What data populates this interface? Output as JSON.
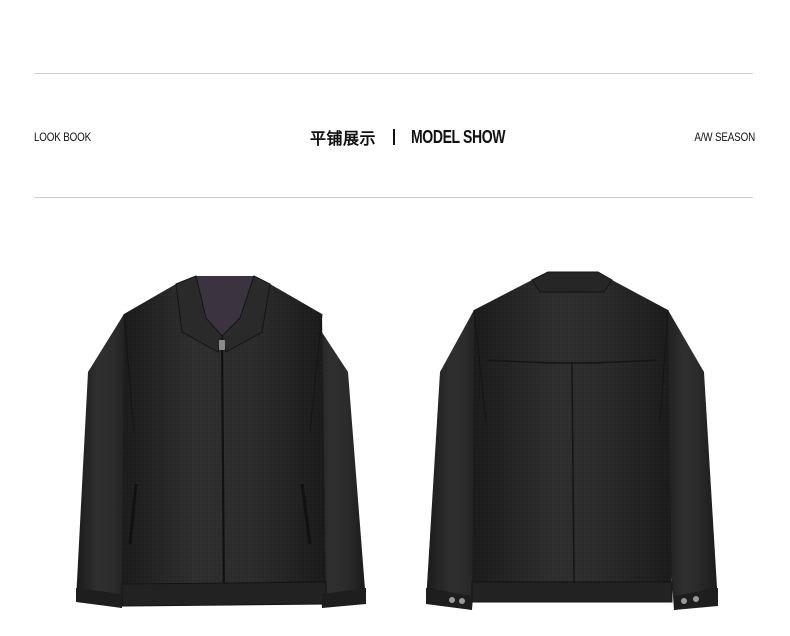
{
  "header": {
    "left_label": "LOOK BOOK",
    "title_cn": "平铺展示",
    "title_en": "MODEL SHOW",
    "right_label": "A/W SEASON"
  },
  "products": [
    {
      "view": "front",
      "icon": "jacket-front-image",
      "color": "#262626"
    },
    {
      "view": "back",
      "icon": "jacket-back-image",
      "color": "#262626"
    }
  ]
}
